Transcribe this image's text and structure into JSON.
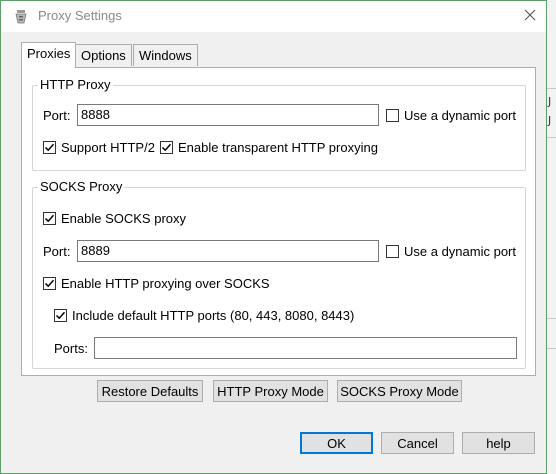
{
  "window": {
    "title": "Proxy Settings"
  },
  "tabs": [
    {
      "label": "Proxies"
    },
    {
      "label": "Options"
    },
    {
      "label": "Windows"
    }
  ],
  "http_proxy": {
    "group_title": "HTTP Proxy",
    "port_label": "Port:",
    "port_value": "8888",
    "dynamic_port_label": "Use a dynamic port",
    "dynamic_port_checked": false,
    "http2_label": "Support HTTP/2",
    "http2_checked": true,
    "transparent_label": "Enable transparent HTTP proxying",
    "transparent_checked": true
  },
  "socks_proxy": {
    "group_title": "SOCKS Proxy",
    "enable_label": "Enable SOCKS proxy",
    "enable_checked": true,
    "port_label": "Port:",
    "port_value": "8889",
    "dynamic_port_label": "Use a dynamic port",
    "dynamic_port_checked": false,
    "http_over_socks_label": "Enable HTTP proxying over SOCKS",
    "http_over_socks_checked": true,
    "default_ports_label": "Include default HTTP ports (80, 443, 8080, 8443)",
    "default_ports_checked": true,
    "ports_label": "Ports:",
    "ports_value": ""
  },
  "mode_buttons": {
    "restore": "Restore Defaults",
    "http_mode": "HTTP Proxy Mode",
    "socks_mode": "SOCKS Proxy Mode"
  },
  "dialog_buttons": {
    "ok": "OK",
    "cancel": "Cancel",
    "help": "help"
  },
  "background_glyphs": [
    "J",
    "J"
  ],
  "colors": {
    "dialog_border": "#5d9f6a",
    "default_button_border": "#0078d7",
    "client_background": "#f0f0f0"
  }
}
